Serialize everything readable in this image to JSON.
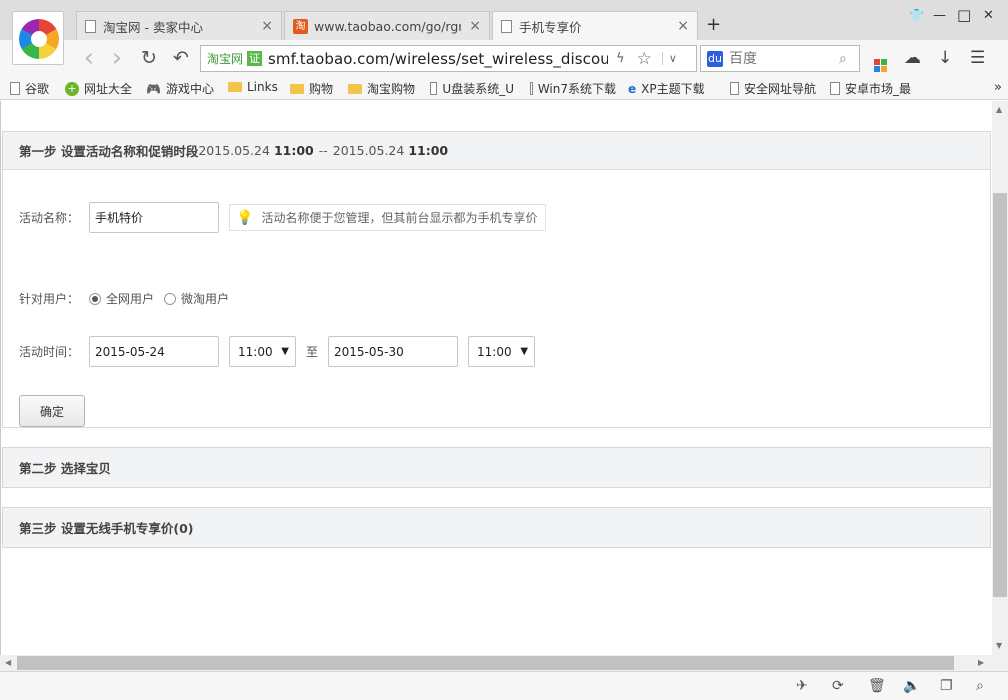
{
  "browser": {
    "tabs": [
      {
        "title": "淘宝网 - 卖家中心",
        "close": "×",
        "active": false
      },
      {
        "title": "www.taobao.com/go/rgn/",
        "close": "×",
        "active": false
      },
      {
        "title": "手机专享价",
        "close": "×",
        "active": true
      }
    ],
    "new_tab": "+",
    "window_controls": {
      "skin": "👕",
      "minimize": "—",
      "maximize": "□",
      "close": "✕"
    },
    "nav": {
      "back": "‹",
      "forward": "›",
      "reload": "↻",
      "undo": "↶"
    },
    "address": {
      "site_badge": "淘宝网",
      "verify_badge": "证",
      "url": "smf.taobao.com/wireless/set_wireless_discount"
    },
    "search": {
      "engine_icon": "du",
      "placeholder": "百度"
    },
    "bookmarks": [
      {
        "label": "谷歌",
        "icon": "page"
      },
      {
        "label": "网址大全",
        "icon": "green"
      },
      {
        "label": "游戏中心",
        "icon": "gamepad"
      },
      {
        "label": "Links",
        "icon": "folder"
      },
      {
        "label": "购物",
        "icon": "folder"
      },
      {
        "label": "淘宝购物",
        "icon": "folder"
      },
      {
        "label": "U盘装系统_U",
        "icon": "page"
      },
      {
        "label": "Win7系统下载",
        "icon": "page"
      },
      {
        "label": "XP主题下载",
        "icon": "blue"
      },
      {
        "label": "安全网址导航",
        "icon": "page"
      },
      {
        "label": "安卓市场_最",
        "icon": "page"
      }
    ],
    "bookmarks_more": "»"
  },
  "step1": {
    "title": "第一步 设置活动名称和促销时段",
    "start_date": "2015.05.24",
    "start_time": "11:00",
    "separator": "--",
    "end_date": "2015.05.24",
    "end_time": "11:00",
    "name_label": "活动名称：",
    "name_value": "手机特价",
    "name_tip": "活动名称便于您管理，但其前台显示都为手机专享价",
    "users_label": "针对用户：",
    "user_options": [
      {
        "label": "全网用户",
        "selected": true
      },
      {
        "label": "微淘用户",
        "selected": false
      }
    ],
    "time_label": "活动时间：",
    "from_date": "2015-05-24",
    "from_time": "11:00",
    "to_sep": "至",
    "to_date": "2015-05-30",
    "to_time": "11:00",
    "confirm_label": "确定"
  },
  "step2": {
    "title": "第二步 选择宝贝"
  },
  "step3": {
    "title": "第三步 设置无线手机专享价(0)"
  },
  "colors": {
    "panel_header": "#f2f3f5",
    "accent_green": "#5bb94b",
    "tip_bulb": "#f1a33b"
  }
}
